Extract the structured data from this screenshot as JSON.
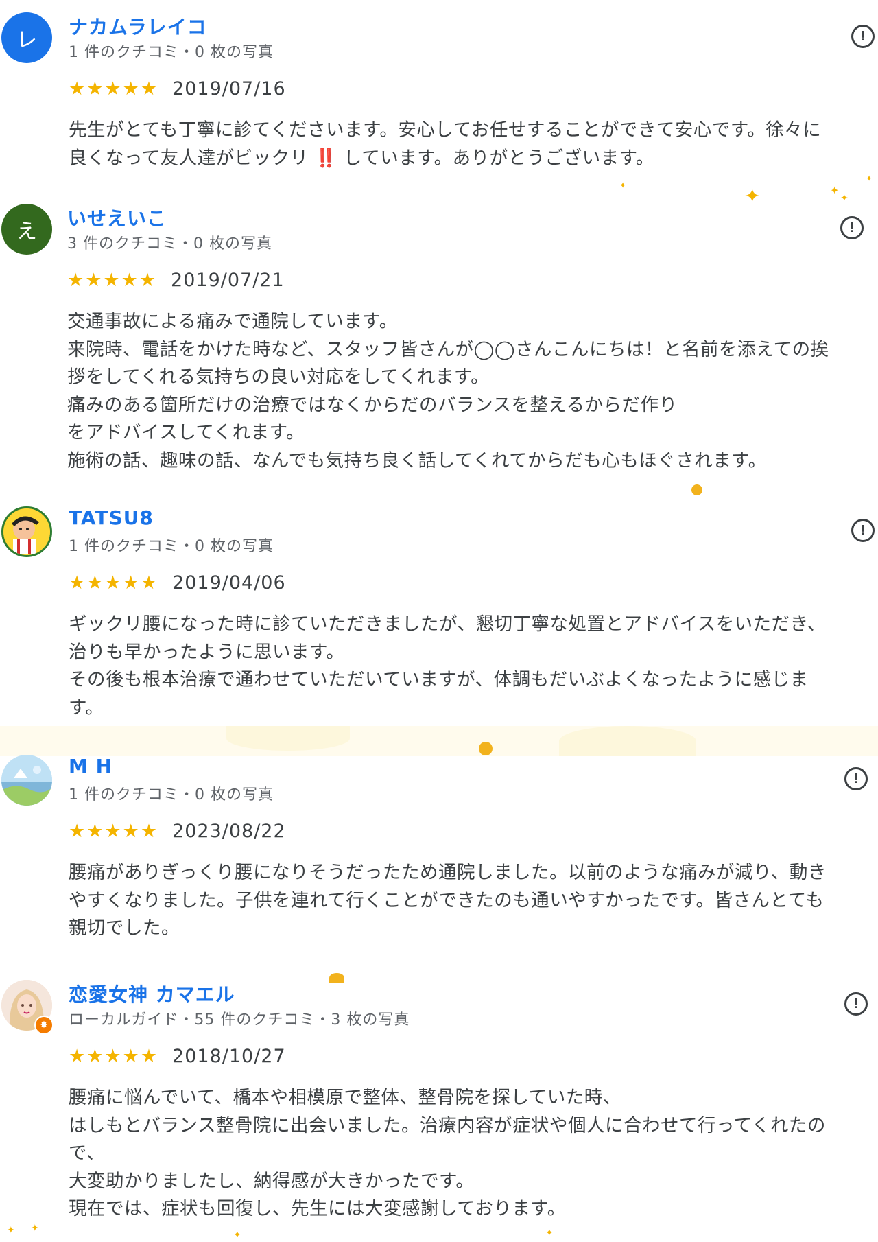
{
  "reviews": [
    {
      "avatar": {
        "letter": "レ",
        "color": "#1a73e8"
      },
      "name": "ナカムラレイコ",
      "meta": "1 件のクチコミ・0 枚の写真",
      "stars": "★★★★★",
      "date": "2019/07/16",
      "text": "先生がとても丁寧に診てくださいます。安心してお任せすることができて安心です。徐々に\n良くなって友人達がビックリ ‼️ しています。ありがとうございます。"
    },
    {
      "avatar": {
        "letter": "え",
        "color": "#33691e"
      },
      "name": "いせえいこ",
      "meta": "3 件のクチコミ・0 枚の写真",
      "stars": "★★★★★",
      "date": "2019/07/21",
      "text": "交通事故による痛みで通院しています。\n来院時、電話をかけた時など、スタッフ皆さんが◯◯さんこんにちは！と名前を添えての挨\n拶をしてくれる気持ちの良い対応をしてくれます。\n痛みのある箇所だけの治療ではなくからだのバランスを整えるからだ作り\nをアドバイスしてくれます。\n施術の話、趣味の話、なんでも気持ち良く話してくれてからだも心もほぐされます。"
    },
    {
      "avatar": {
        "letter": "",
        "color": "#fbc02d"
      },
      "name": "TATSU8",
      "meta": "1 件のクチコミ・0 枚の写真",
      "stars": "★★★★★",
      "date": "2019/04/06",
      "text": "ギックリ腰になった時に診ていただきましたが、懇切丁寧な処置とアドバイスをいただき、\n治りも早かったように思います。\nその後も根本治療で通わせていただいていますが、体調もだいぶよくなったように感じま\nす。"
    },
    {
      "avatar": {
        "letter": "",
        "color": "#9ecbe8"
      },
      "name": "M H",
      "meta": "1 件のクチコミ・0 枚の写真",
      "stars": "★★★★★",
      "date": "2023/08/22",
      "text": "腰痛がありぎっくり腰になりそうだったため通院しました。以前のような痛みが減り、動き\nやすくなりました。子供を連れて行くことができたのも通いやすかったです。皆さんとても\n親切でした。"
    },
    {
      "avatar": {
        "letter": "",
        "color": "#e8cfc2"
      },
      "name": "恋愛女神 カマエル",
      "meta": "ローカルガイド・55 件のクチコミ・3 枚の写真",
      "stars": "★★★★★",
      "date": "2018/10/27",
      "text": "腰痛に悩んでいて、橋本や相模原で整体、整骨院を探していた時、\nはしもとバランス整骨院に出会いました。治療内容が症状や個人に合わせて行ってくれたの\nで、\n大変助かりましたし、納得感が大きかったです。\n現在では、症状も回復し、先生には大変感謝しております。"
    }
  ],
  "report_icon": "!",
  "colors": {
    "name": "#1a73e8",
    "star": "#f4b400",
    "accent": "#f2b21d"
  }
}
